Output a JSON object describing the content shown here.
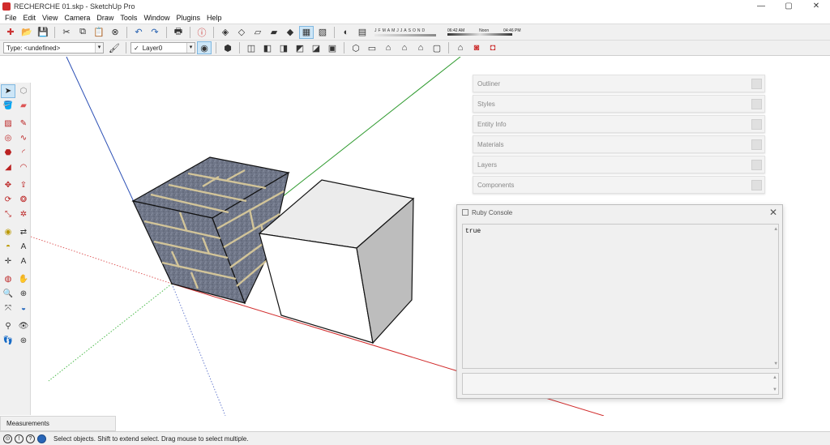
{
  "window": {
    "title": "RECHERCHE 01.skp - SketchUp Pro",
    "minimize": "—",
    "maximize": "▢",
    "close": "✕"
  },
  "menu": [
    "File",
    "Edit",
    "View",
    "Camera",
    "Draw",
    "Tools",
    "Window",
    "Plugins",
    "Help"
  ],
  "shadow_settings": {
    "months": [
      "J",
      "F",
      "M",
      "A",
      "M",
      "J",
      "J",
      "A",
      "S",
      "O",
      "N",
      "D"
    ],
    "time_start": "06:42 AM",
    "time_mid": "Noon",
    "time_end": "04:46 PM"
  },
  "entity_type": {
    "label": "Type: <undefined>"
  },
  "layer": {
    "check": "✓",
    "name": "Layer0"
  },
  "tray": [
    "Outliner",
    "Styles",
    "Entity Info",
    "Materials",
    "Layers",
    "Components"
  ],
  "ruby_console": {
    "title": "Ruby Console",
    "output": "true",
    "close": "✕"
  },
  "measurements": {
    "label": "Measurements"
  },
  "status": {
    "message": "Select objects. Shift to extend select. Drag mouse to select multiple."
  },
  "colors": {
    "axis_red": "#d12b2b",
    "axis_green": "#2e9a2e",
    "axis_blue": "#2b4fb5",
    "brick_grey": "#6f7688",
    "mortar": "#d8c99a"
  }
}
